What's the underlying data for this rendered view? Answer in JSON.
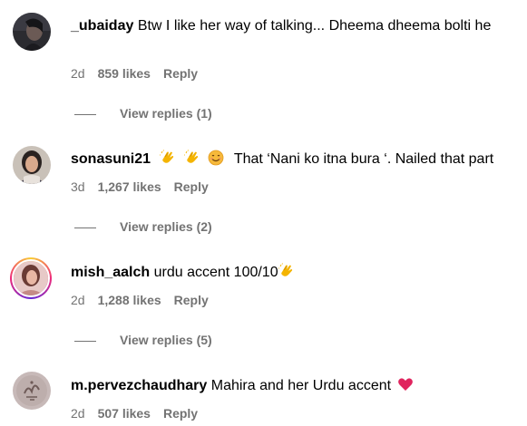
{
  "comments": [
    {
      "username": "_ubaiday",
      "text": "Btw I like her way of talking... Dheema dheema bolti he",
      "time": "2d",
      "likes": "859 likes",
      "reply": "Reply",
      "view_replies": "View replies (1)",
      "avatar": "avatar-photo-dark"
    },
    {
      "username": "sonasuni21",
      "text_after_emoji": "That ‘Nani ko itna bura ‘. Nailed that part",
      "emojis": [
        "clapping-hands-icon",
        "clapping-hands-icon",
        "smiling-face-icon"
      ],
      "time": "3d",
      "likes": "1,267 likes",
      "reply": "Reply",
      "view_replies": "View replies (2)",
      "avatar": "avatar-photo-woman"
    },
    {
      "username": "mish_aalch",
      "text": "urdu accent 100/10",
      "emojis": [
        "clapping-hands-icon"
      ],
      "time": "2d",
      "likes": "1,288 likes",
      "reply": "Reply",
      "view_replies": "View replies (5)",
      "avatar": "avatar-photo-story-ring"
    },
    {
      "username": "m.pervezchaudhary",
      "text": "Mahira and her Urdu accent",
      "emojis": [
        "red-heart-icon"
      ],
      "time": "2d",
      "likes": "507 likes",
      "reply": "Reply",
      "avatar": "avatar-photo-calligraphy"
    }
  ],
  "colors": {
    "text": "#000000",
    "secondary": "#737373",
    "heart": "#e0245e",
    "clap": "#f4b400"
  }
}
